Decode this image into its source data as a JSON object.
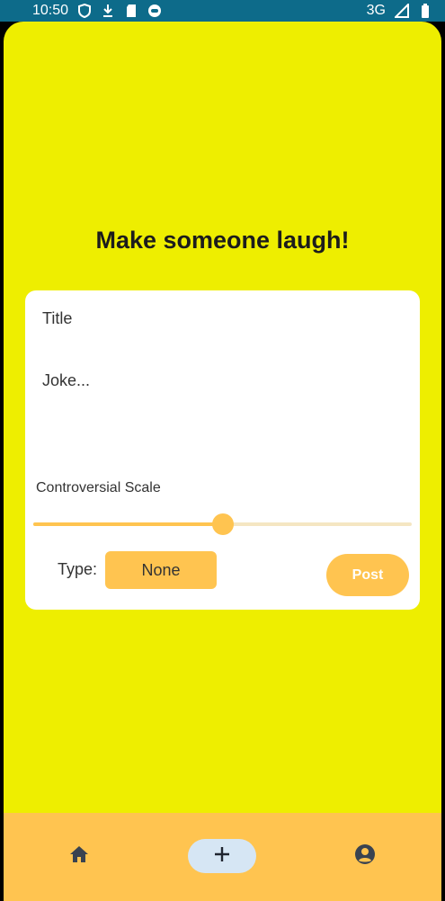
{
  "status_bar": {
    "time": "10:50",
    "network": "3G",
    "left_icons": [
      "shield-icon",
      "download-icon",
      "sd-card-icon",
      "face-icon"
    ],
    "right_icons": [
      "signal-icon",
      "battery-icon"
    ]
  },
  "colors": {
    "background": "#eeee00",
    "accent": "#ffc450",
    "status_bar": "#0d6b8a",
    "nav_selected": "#d6e6f4"
  },
  "heading": "Make someone laugh!",
  "form": {
    "title_placeholder": "Title",
    "joke_placeholder": "Joke...",
    "scale_label": "Controversial Scale",
    "scale_value_fraction": 0.5,
    "type_label": "Type:",
    "type_value": "None",
    "post_label": "Post"
  },
  "bottom_nav": {
    "items": [
      {
        "icon": "home-icon"
      },
      {
        "icon": "plus-icon",
        "selected": true
      },
      {
        "icon": "account-icon"
      }
    ]
  }
}
